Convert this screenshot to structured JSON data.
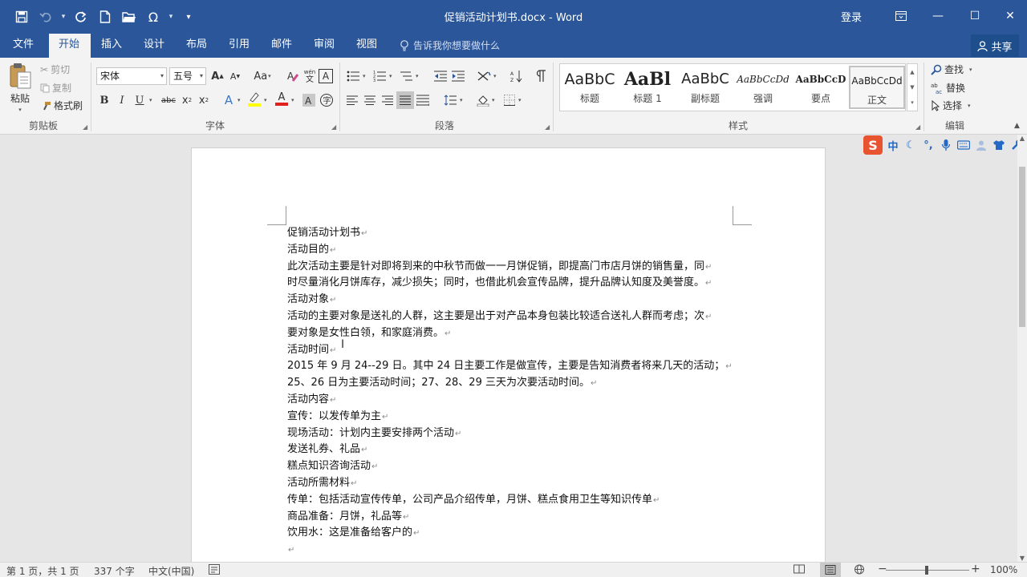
{
  "window": {
    "title": "促销活动计划书.docx  -  Word",
    "login_label": "登录",
    "qat": [
      "save-icon",
      "undo-icon",
      "redo-icon",
      "new-doc-icon",
      "open-icon",
      "symbol-icon",
      "customize-icon"
    ],
    "minimize": "—",
    "maximize": "☐",
    "close": "✕"
  },
  "tabs": [
    "文件",
    "开始",
    "插入",
    "设计",
    "布局",
    "引用",
    "邮件",
    "审阅",
    "视图"
  ],
  "tell_me": "告诉我你想要做什么",
  "share_label": "共享",
  "clipboard": {
    "paste": "粘贴",
    "cut": "剪切",
    "copy": "复制",
    "format_painter": "格式刷",
    "label": "剪贴板"
  },
  "font": {
    "name": "宋体",
    "size": "五号",
    "change_case": "Aa",
    "wen": "wén",
    "char_a": "A",
    "bold": "B",
    "italic": "I",
    "underline": "U",
    "strike": "abc",
    "sub": "x",
    "sub_mark": "2",
    "sup": "x",
    "sup_mark": "2",
    "effect": "A",
    "color": "A",
    "label": "字体",
    "highlight_color": "#ffff00",
    "font_color_value": "#e0201c"
  },
  "paragraph": {
    "label": "段落"
  },
  "styles": {
    "items": [
      {
        "sample": "AaBbC",
        "name": "标题"
      },
      {
        "sample": "AaBl",
        "name": "标题 1"
      },
      {
        "sample": "AaBbC",
        "name": "副标题"
      },
      {
        "sample": "AaBbCcDd",
        "name": "强调"
      },
      {
        "sample": "AaBbCcD",
        "name": "要点"
      },
      {
        "sample": "AaBbCcDd",
        "name": "正文"
      }
    ],
    "label": "样式"
  },
  "editing": {
    "find": "查找",
    "replace": "替换",
    "select": "选择",
    "label": "编辑"
  },
  "document": {
    "lines": [
      "促销活动计划书",
      "活动目的",
      "此次活动主要是针对即将到来的中秋节而做一一月饼促销，即提高门市店月饼的销售量，同",
      "时尽量消化月饼库存，减少损失；同时，也借此机会宣传品牌，提升品牌认知度及美誉度。",
      "活动对象",
      "活动的主要对象是送礼的人群，这主要是出于对产品本身包装比较适合送礼人群而考虑；次",
      "要对象是女性白领，和家庭消费。",
      "活动时间",
      "2015 年 9 月 24--29 日。其中 24 日主要工作是做宣传，主要是告知消费者将来几天的活动；",
      "25、26 日为主要活动时间；27、28、29 三天为次要活动时间。",
      "活动内容",
      "宣传：以发传单为主",
      "现场活动：计划内主要安排两个活动",
      "发送礼券、礼品",
      "糕点知识咨询活动",
      "活动所需材料",
      "传单：包括活动宣传传单，公司产品介绍传单，月饼、糕点食用卫生等知识传单",
      "商品准备：月饼，礼品等",
      "饮用水：这是准备给客户的",
      ""
    ],
    "para_mark": "↵"
  },
  "ime": {
    "logo": "S",
    "mode": "中"
  },
  "status": {
    "page": "第 1 页，共 1 页",
    "words": "337 个字",
    "lang": "中文(中国)",
    "zoom": "100%",
    "zoom_minus": "−",
    "zoom_plus": "+"
  }
}
